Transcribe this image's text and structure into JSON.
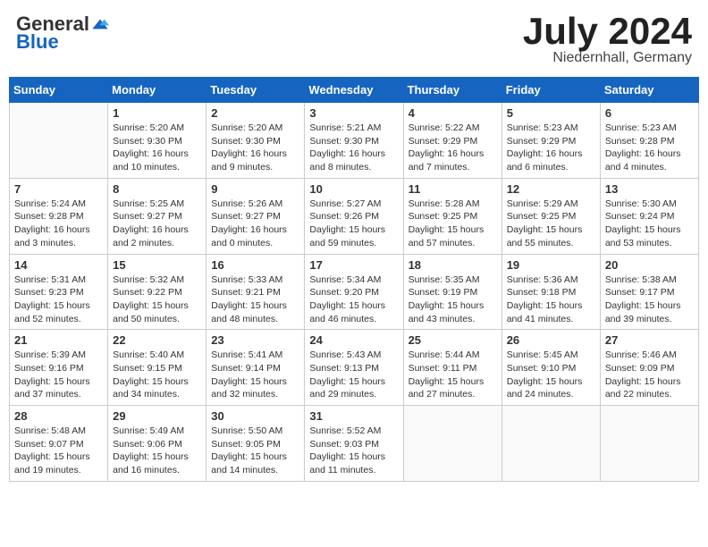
{
  "header": {
    "logo": {
      "general": "General",
      "blue": "Blue"
    },
    "title": "July 2024",
    "location": "Niedernhall, Germany"
  },
  "weekdays": [
    "Sunday",
    "Monday",
    "Tuesday",
    "Wednesday",
    "Thursday",
    "Friday",
    "Saturday"
  ],
  "weeks": [
    [
      {
        "day": null,
        "info": null
      },
      {
        "day": 1,
        "info": "Sunrise: 5:20 AM\nSunset: 9:30 PM\nDaylight: 16 hours\nand 10 minutes."
      },
      {
        "day": 2,
        "info": "Sunrise: 5:20 AM\nSunset: 9:30 PM\nDaylight: 16 hours\nand 9 minutes."
      },
      {
        "day": 3,
        "info": "Sunrise: 5:21 AM\nSunset: 9:30 PM\nDaylight: 16 hours\nand 8 minutes."
      },
      {
        "day": 4,
        "info": "Sunrise: 5:22 AM\nSunset: 9:29 PM\nDaylight: 16 hours\nand 7 minutes."
      },
      {
        "day": 5,
        "info": "Sunrise: 5:23 AM\nSunset: 9:29 PM\nDaylight: 16 hours\nand 6 minutes."
      },
      {
        "day": 6,
        "info": "Sunrise: 5:23 AM\nSunset: 9:28 PM\nDaylight: 16 hours\nand 4 minutes."
      }
    ],
    [
      {
        "day": 7,
        "info": "Sunrise: 5:24 AM\nSunset: 9:28 PM\nDaylight: 16 hours\nand 3 minutes."
      },
      {
        "day": 8,
        "info": "Sunrise: 5:25 AM\nSunset: 9:27 PM\nDaylight: 16 hours\nand 2 minutes."
      },
      {
        "day": 9,
        "info": "Sunrise: 5:26 AM\nSunset: 9:27 PM\nDaylight: 16 hours\nand 0 minutes."
      },
      {
        "day": 10,
        "info": "Sunrise: 5:27 AM\nSunset: 9:26 PM\nDaylight: 15 hours\nand 59 minutes."
      },
      {
        "day": 11,
        "info": "Sunrise: 5:28 AM\nSunset: 9:25 PM\nDaylight: 15 hours\nand 57 minutes."
      },
      {
        "day": 12,
        "info": "Sunrise: 5:29 AM\nSunset: 9:25 PM\nDaylight: 15 hours\nand 55 minutes."
      },
      {
        "day": 13,
        "info": "Sunrise: 5:30 AM\nSunset: 9:24 PM\nDaylight: 15 hours\nand 53 minutes."
      }
    ],
    [
      {
        "day": 14,
        "info": "Sunrise: 5:31 AM\nSunset: 9:23 PM\nDaylight: 15 hours\nand 52 minutes."
      },
      {
        "day": 15,
        "info": "Sunrise: 5:32 AM\nSunset: 9:22 PM\nDaylight: 15 hours\nand 50 minutes."
      },
      {
        "day": 16,
        "info": "Sunrise: 5:33 AM\nSunset: 9:21 PM\nDaylight: 15 hours\nand 48 minutes."
      },
      {
        "day": 17,
        "info": "Sunrise: 5:34 AM\nSunset: 9:20 PM\nDaylight: 15 hours\nand 46 minutes."
      },
      {
        "day": 18,
        "info": "Sunrise: 5:35 AM\nSunset: 9:19 PM\nDaylight: 15 hours\nand 43 minutes."
      },
      {
        "day": 19,
        "info": "Sunrise: 5:36 AM\nSunset: 9:18 PM\nDaylight: 15 hours\nand 41 minutes."
      },
      {
        "day": 20,
        "info": "Sunrise: 5:38 AM\nSunset: 9:17 PM\nDaylight: 15 hours\nand 39 minutes."
      }
    ],
    [
      {
        "day": 21,
        "info": "Sunrise: 5:39 AM\nSunset: 9:16 PM\nDaylight: 15 hours\nand 37 minutes."
      },
      {
        "day": 22,
        "info": "Sunrise: 5:40 AM\nSunset: 9:15 PM\nDaylight: 15 hours\nand 34 minutes."
      },
      {
        "day": 23,
        "info": "Sunrise: 5:41 AM\nSunset: 9:14 PM\nDaylight: 15 hours\nand 32 minutes."
      },
      {
        "day": 24,
        "info": "Sunrise: 5:43 AM\nSunset: 9:13 PM\nDaylight: 15 hours\nand 29 minutes."
      },
      {
        "day": 25,
        "info": "Sunrise: 5:44 AM\nSunset: 9:11 PM\nDaylight: 15 hours\nand 27 minutes."
      },
      {
        "day": 26,
        "info": "Sunrise: 5:45 AM\nSunset: 9:10 PM\nDaylight: 15 hours\nand 24 minutes."
      },
      {
        "day": 27,
        "info": "Sunrise: 5:46 AM\nSunset: 9:09 PM\nDaylight: 15 hours\nand 22 minutes."
      }
    ],
    [
      {
        "day": 28,
        "info": "Sunrise: 5:48 AM\nSunset: 9:07 PM\nDaylight: 15 hours\nand 19 minutes."
      },
      {
        "day": 29,
        "info": "Sunrise: 5:49 AM\nSunset: 9:06 PM\nDaylight: 15 hours\nand 16 minutes."
      },
      {
        "day": 30,
        "info": "Sunrise: 5:50 AM\nSunset: 9:05 PM\nDaylight: 15 hours\nand 14 minutes."
      },
      {
        "day": 31,
        "info": "Sunrise: 5:52 AM\nSunset: 9:03 PM\nDaylight: 15 hours\nand 11 minutes."
      },
      {
        "day": null,
        "info": null
      },
      {
        "day": null,
        "info": null
      },
      {
        "day": null,
        "info": null
      }
    ]
  ]
}
